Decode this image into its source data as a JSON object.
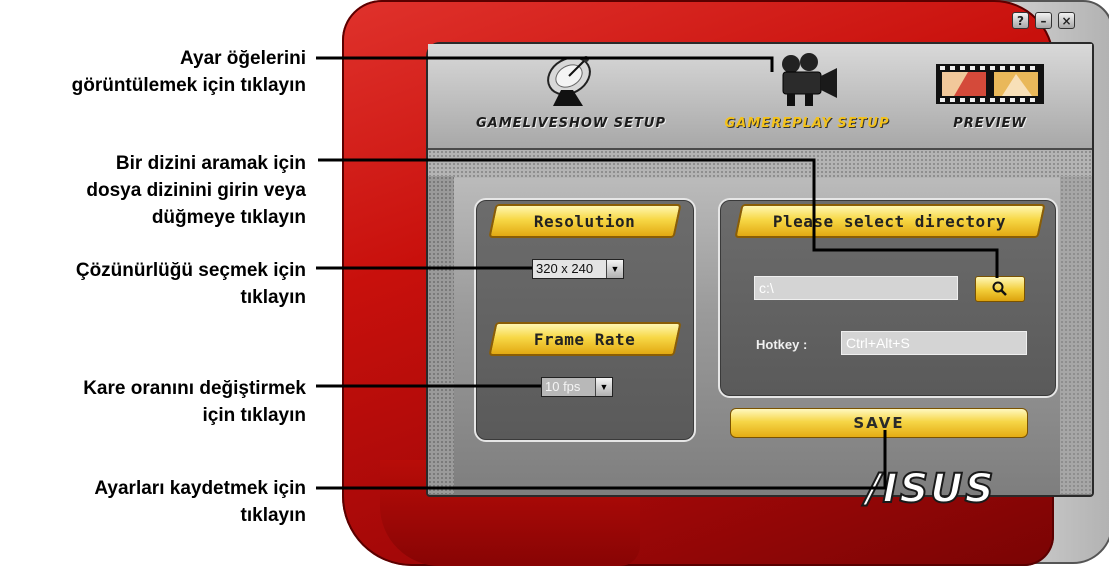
{
  "callouts": {
    "view_settings": [
      "Ayar öğelerini",
      "görüntülemek için tıklayın"
    ],
    "directory": [
      "Bir dizini aramak için",
      "dosya dizinini girin veya",
      "düğmeye tıklayın"
    ],
    "resolution": [
      "Çözünürlüğü seçmek için",
      "tıklayın"
    ],
    "frame_rate": [
      "Kare oranını değiştirmek",
      "için tıklayın"
    ],
    "save": [
      "Ayarları kaydetmek için",
      "tıklayın"
    ]
  },
  "window": {
    "controls": {
      "help": "?",
      "minimize": "–",
      "close": "×"
    }
  },
  "toolbar": {
    "items": [
      {
        "label": "GAMELIVESHOW SETUP",
        "icon": "satellite-dish-icon",
        "active": false
      },
      {
        "label": "GAMEREPLAY SETUP",
        "icon": "video-camera-icon",
        "active": true
      },
      {
        "label": "PREVIEW",
        "icon": "film-strip-icon",
        "active": false
      }
    ]
  },
  "resolution": {
    "title": "Resolution",
    "selected": "320 x 240"
  },
  "frame_rate": {
    "title": "Frame Rate",
    "selected": "10 fps"
  },
  "directory": {
    "title": "Please select directory",
    "path": "c:\\",
    "hotkey_label": "Hotkey :",
    "hotkey_value": "Ctrl+Alt+S"
  },
  "save_label": "SAVE",
  "brand": "/ISUS",
  "colors": {
    "frame_red": "#c8100c",
    "accent_yellow": "#f3c21d",
    "panel_grey": "#5f5f5f"
  }
}
